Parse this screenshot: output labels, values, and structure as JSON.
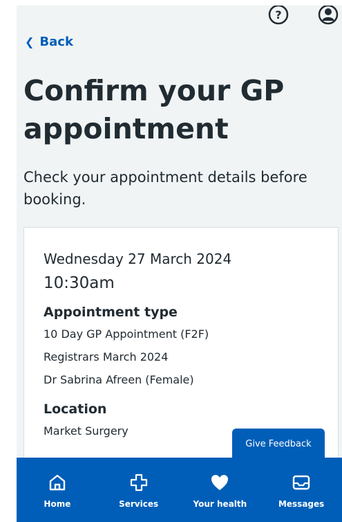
{
  "header": {
    "back_label": "Back"
  },
  "page": {
    "title": "Confirm your GP appointment",
    "lede": "Check your appointment details before booking."
  },
  "appointment": {
    "date": "Wednesday 27 March 2024",
    "time": "10:30am",
    "type_heading": "Appointment type",
    "type_lines": [
      "10 Day GP Appointment (F2F)",
      "Registrars March 2024",
      "Dr Sabrina Afreen (Female)"
    ],
    "location_heading": "Location",
    "location": "Market Surgery"
  },
  "feedback": {
    "label": "Give Feedback"
  },
  "tabbar": {
    "tabs": [
      {
        "label": "Home",
        "icon": "home-icon"
      },
      {
        "label": "Services",
        "icon": "services-cross-icon"
      },
      {
        "label": "Your health",
        "icon": "heart-icon"
      },
      {
        "label": "Messages",
        "icon": "messages-inbox-icon"
      }
    ]
  },
  "colors": {
    "brand": "#005eb8",
    "background": "#f0f4f5",
    "text": "#212b32"
  }
}
